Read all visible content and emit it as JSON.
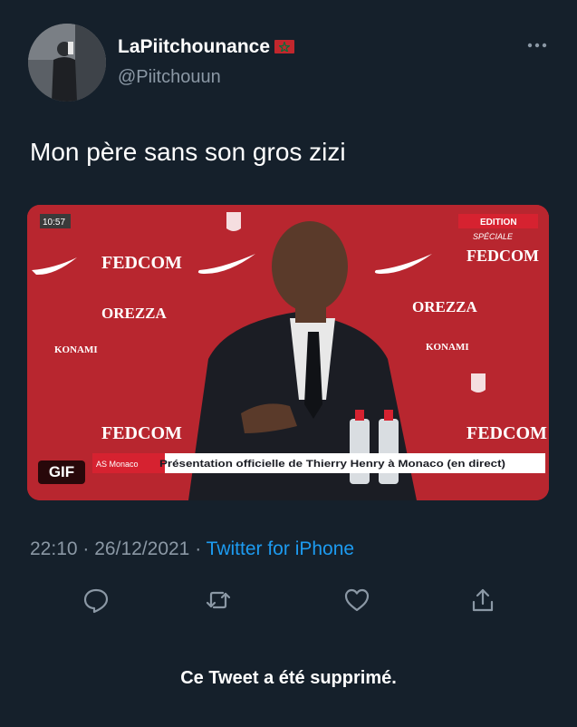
{
  "author": {
    "display_name": "LaPiitchounance",
    "handle": "@Piitchouun"
  },
  "tweet": {
    "text": "Mon père sans son gros zizi",
    "time": "22:10",
    "separator": "·",
    "date": "26/12/2021",
    "source": "Twitter for iPhone",
    "deleted_notice": "Ce Tweet a été supprimé."
  },
  "media": {
    "badge": "GIF",
    "clock": "10:57",
    "edition_label": "EDITION",
    "speciale_label": "SPÉCIALE",
    "sponsor_fedcom": "FEDCOM",
    "sponsor_orezza": "OREZZA",
    "sponsor_konami": "KONAMI",
    "ticker_left": "AS Monaco",
    "ticker_text": "Présentation officielle de Thierry Henry à Monaco (en direct)"
  },
  "icons": {
    "more": "more-options-icon",
    "reply": "reply-icon",
    "retweet": "retweet-icon",
    "like": "like-icon",
    "share": "share-icon"
  },
  "colors": {
    "background": "#15202b",
    "secondary_text": "#8b98a5",
    "accent": "#1d9bf0",
    "monaco_red": "#c3202b"
  }
}
